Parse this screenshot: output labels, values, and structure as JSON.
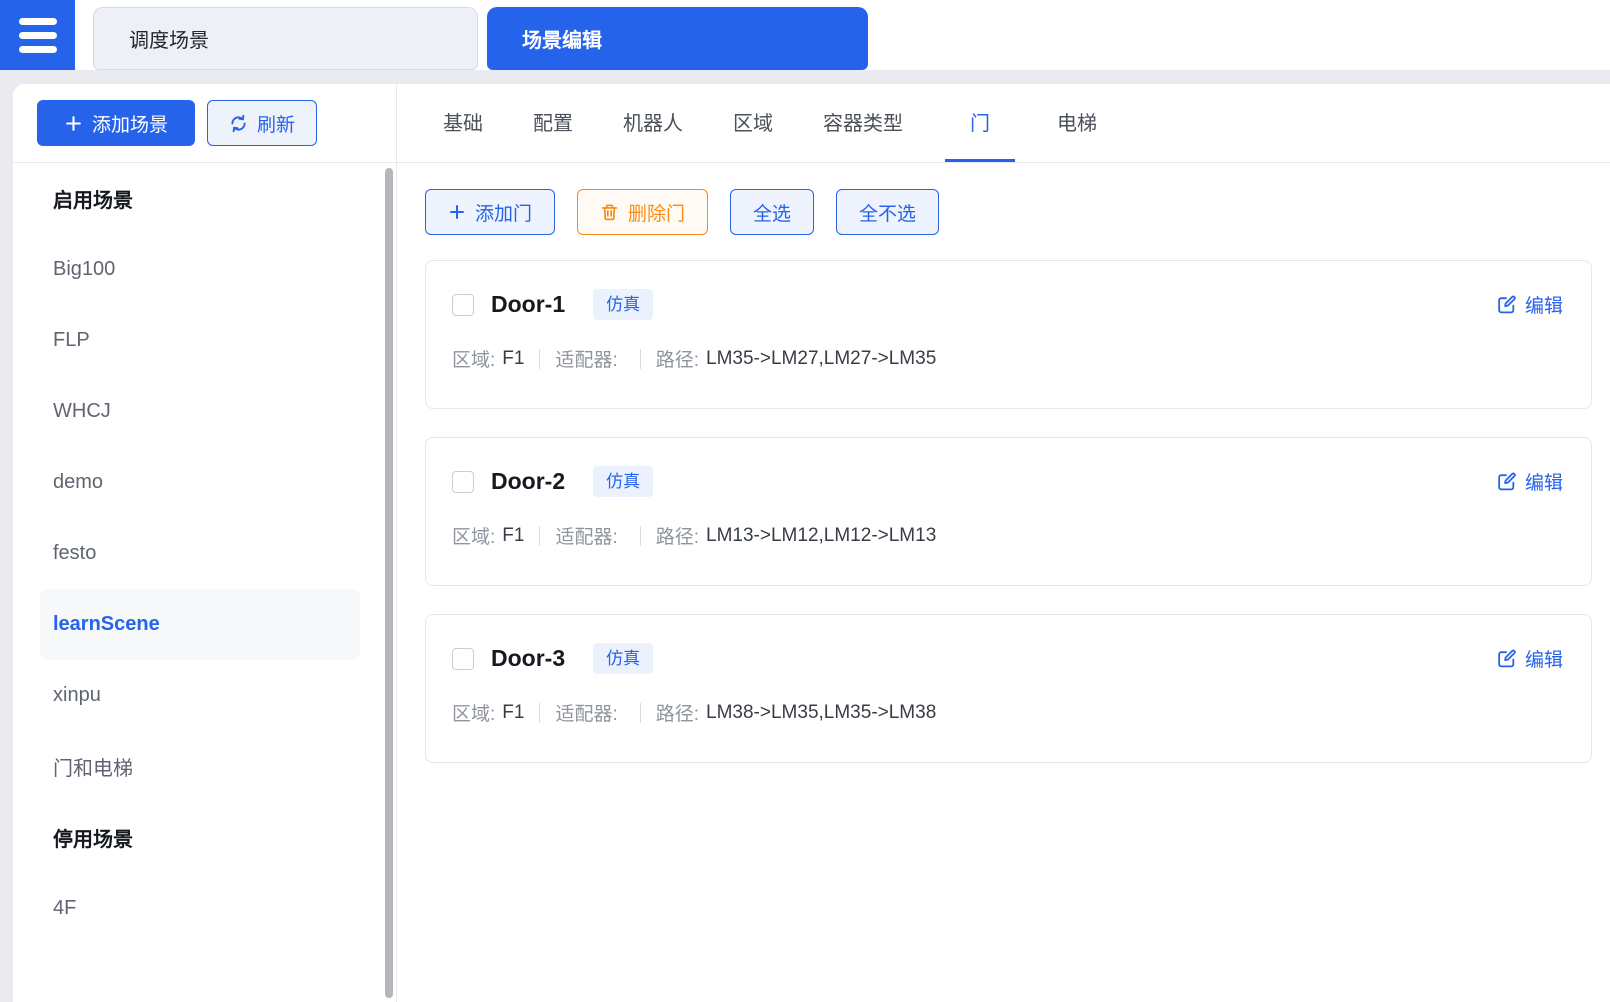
{
  "topbar": {
    "tabs": [
      {
        "label": "调度场景",
        "active": false
      },
      {
        "label": "场景编辑",
        "active": true
      }
    ]
  },
  "sidebar": {
    "add_scene_button": "添加场景",
    "refresh_button": "刷新",
    "enabled_header": "启用场景",
    "disabled_header": "停用场景",
    "enabled_items": [
      "Big100",
      "FLP",
      "WHCJ",
      "demo",
      "festo",
      "learnScene",
      "xinpu",
      "门和电梯"
    ],
    "disabled_items": [
      "4F"
    ],
    "selected_item": "learnScene"
  },
  "main": {
    "tabs": [
      "基础",
      "配置",
      "机器人",
      "区域",
      "容器类型",
      "门",
      "电梯"
    ],
    "active_tab": "门",
    "toolbar": {
      "add_door": "添加门",
      "delete_door": "删除门",
      "select_all": "全选",
      "select_none": "全不选"
    },
    "door_cards": [
      {
        "name": "Door-1",
        "badge": "仿真",
        "edit": "编辑",
        "area_label": "区域:",
        "area": "F1",
        "adapter_label": "适配器:",
        "adapter": "",
        "path_label": "路径:",
        "path": "LM35->LM27,LM27->LM35",
        "checked": false
      },
      {
        "name": "Door-2",
        "badge": "仿真",
        "edit": "编辑",
        "area_label": "区域:",
        "area": "F1",
        "adapter_label": "适配器:",
        "adapter": "",
        "path_label": "路径:",
        "path": "LM13->LM12,LM12->LM13",
        "checked": false
      },
      {
        "name": "Door-3",
        "badge": "仿真",
        "edit": "编辑",
        "area_label": "区域:",
        "area": "F1",
        "adapter_label": "适配器:",
        "adapter": "",
        "path_label": "路径:",
        "path": "LM38->LM35,LM35->LM38",
        "checked": false
      }
    ]
  },
  "icons": {
    "hamburger": "menu-icon",
    "plus": "plus-icon",
    "refresh": "refresh-icon",
    "trash": "trash-icon",
    "edit": "edit-icon"
  },
  "colors": {
    "primary_blue": "#2563eb",
    "orange": "#fa8c16",
    "badge_bg": "#ebf2fe",
    "page_bg": "#e9ebf0",
    "light_blue_bg": "#eef3fd",
    "light_orange_bg": "#fffaf4"
  }
}
